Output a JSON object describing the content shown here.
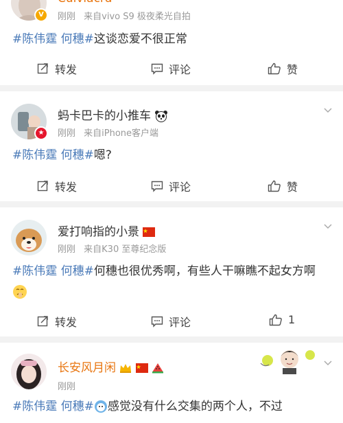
{
  "posts": [
    {
      "username": "Cuiviacrd",
      "time": "刚刚",
      "source": "来自vivo S9 极夜柔光自拍",
      "hashtag": "#陈伟霆 何穗#",
      "text": "这谈恋爱不很正常",
      "actions": {
        "repost": "转发",
        "comment": "评论",
        "like": "赞"
      }
    },
    {
      "username": "蚂卡巴卡的小推车",
      "time": "刚刚",
      "source": "来自iPhone客户端",
      "hashtag": "#陈伟霆 何穗#",
      "text": "嗯?",
      "actions": {
        "repost": "转发",
        "comment": "评论",
        "like": "赞"
      }
    },
    {
      "username": "爱打响指的小景",
      "time": "刚刚",
      "source": "来自K30 至尊纪念版",
      "hashtag": "#陈伟霆 何穗#",
      "text": "何穗也很优秀啊，有些人干嘛瞧不起女方啊",
      "actions": {
        "repost": "转发",
        "comment": "评论",
        "like": "1"
      }
    },
    {
      "username": "长安风月闲",
      "time": "刚刚",
      "source": "",
      "hashtag": "#陈伟霆 何穗#",
      "text": "感觉没有什么交集的两个人，不过"
    }
  ],
  "colors": {
    "hashtag": "#4a7ab8",
    "gold_name": "#e8750f",
    "meta": "#999999",
    "divider": "#f2f2f2"
  },
  "icons": [
    "repost-icon",
    "comment-icon",
    "like-icon",
    "chevron-down-icon",
    "panda-icon",
    "china-flag-icon",
    "crown-icon",
    "watermelon-icon",
    "verified-badge-icon"
  ]
}
